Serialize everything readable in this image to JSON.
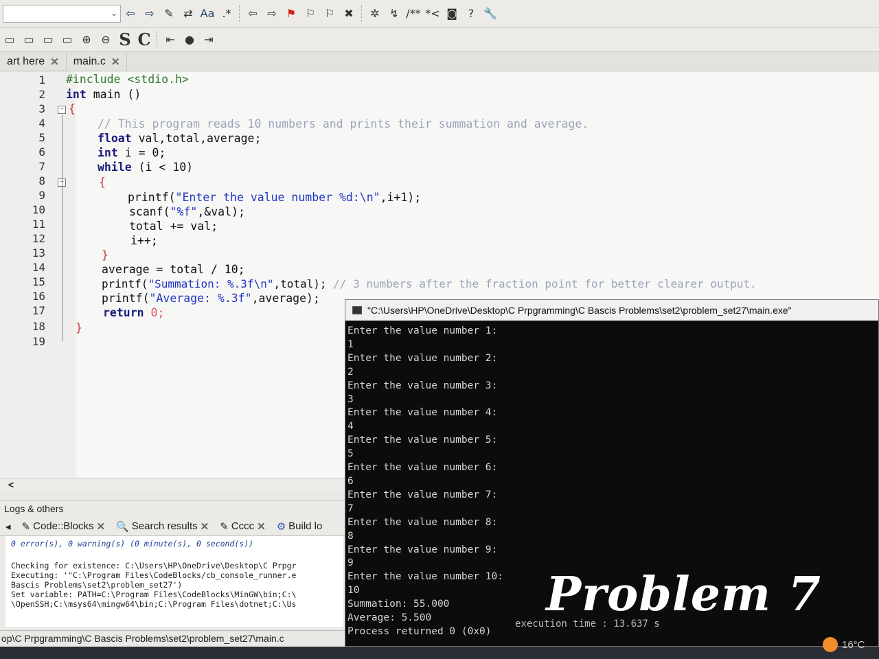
{
  "toolbar1": {
    "icons": [
      "back-arrow",
      "forward-arrow",
      "highlight-pen",
      "replace",
      "match-case-Aa",
      "regex-dotstar",
      "prev-arrow",
      "next-arrow",
      "bookmark-flag",
      "prev-bookmark",
      "next-bookmark",
      "clear-bookmark",
      "debug",
      "step",
      "comment-block",
      "comment-line",
      "window",
      "help",
      "wrench"
    ],
    "match_case": "Aa",
    "regex": ".*",
    "comment_block": "/**",
    "comment_line": "*<"
  },
  "toolbar2": {
    "icons": [
      "box-1",
      "box-2",
      "box-3",
      "zoom-in",
      "zoom-out",
      "select",
      "code-completion",
      "first",
      "dot",
      "last"
    ],
    "s_label": "S",
    "c_label": "C"
  },
  "tabs": [
    {
      "label": "art here"
    },
    {
      "label": "main.c"
    }
  ],
  "editor": {
    "line_numbers": [
      "1",
      "2",
      "3",
      "4",
      "5",
      "6",
      "7",
      "8",
      "9",
      "10",
      "11",
      "12",
      "13",
      "14",
      "15",
      "16",
      "17",
      "18",
      "19"
    ],
    "lines": {
      "l1": "#include <stdio.h>",
      "l2a": "int",
      "l2b": " main ()",
      "l3": "{",
      "l4": "// This program reads 10 numbers and prints their summation and average.",
      "l5a": "float",
      "l5b": " val,total,average;",
      "l6a": "int",
      "l6b": " i = 0;",
      "l7a": "while",
      "l7b": " (i < 10)",
      "l8": "{",
      "l9a": "printf(",
      "l9b": "\"Enter the value number %d:\\n\"",
      "l9c": ",i+1);",
      "l10a": "scanf(",
      "l10b": "\"%f\"",
      "l10c": ",&val);",
      "l11": "total += val;",
      "l12": "i++;",
      "l13": "}",
      "l14": "average = total / 10;",
      "l15a": "printf(",
      "l15b": "\"Summation: %.3f\\n\"",
      "l15c": ",total); ",
      "l15d": "// 3 numbers after the fraction point for better clearer output.",
      "l16a": "printf(",
      "l16b": "\"Average: %.3f\"",
      "l16c": ",average);",
      "l17a": "return",
      "l17b": " 0;",
      "l18": "}"
    }
  },
  "scroll_left": "<",
  "logs": {
    "title": "Logs & others",
    "tabs": [
      "Code::Blocks",
      "Search results",
      "Cccc",
      "Build lo"
    ],
    "summary": "0 error(s), 0 warning(s) (0 minute(s), 0 second(s))",
    "lines": [
      "Checking for existence: C:\\Users\\HP\\OneDrive\\Desktop\\C Prpgr",
      "Executing: '\"C:\\Program Files\\CodeBlocks/cb_console_runner.e",
      "Bascis Problems\\set2\\problem_set27')",
      "Set variable: PATH=C:\\Program Files\\CodeBlocks\\MinGW\\bin;C:\\",
      "\\OpenSSH;C:\\msys64\\mingw64\\bin;C:\\Program Files\\dotnet;C:\\Us"
    ]
  },
  "status_path": "op\\C Prpgramming\\C Bascis Problems\\set2\\problem_set27\\main.c",
  "console": {
    "title": "\"C:\\Users\\HP\\OneDrive\\Desktop\\C Prpgramming\\C Bascis Problems\\set2\\problem_set27\\main.exe\"",
    "output": "Enter the value number 1:\n1\nEnter the value number 2:\n2\nEnter the value number 3:\n3\nEnter the value number 4:\n4\nEnter the value number 5:\n5\nEnter the value number 6:\n6\nEnter the value number 7:\n7\nEnter the value number 8:\n8\nEnter the value number 9:\n9\nEnter the value number 10:\n10\nSummation: 55.000\nAverage: 5.500\nProcess returned 0 (0x0)",
    "exec_time": "execution time : 13.637 s"
  },
  "overlay": "Problem 7",
  "weather": "16°C"
}
